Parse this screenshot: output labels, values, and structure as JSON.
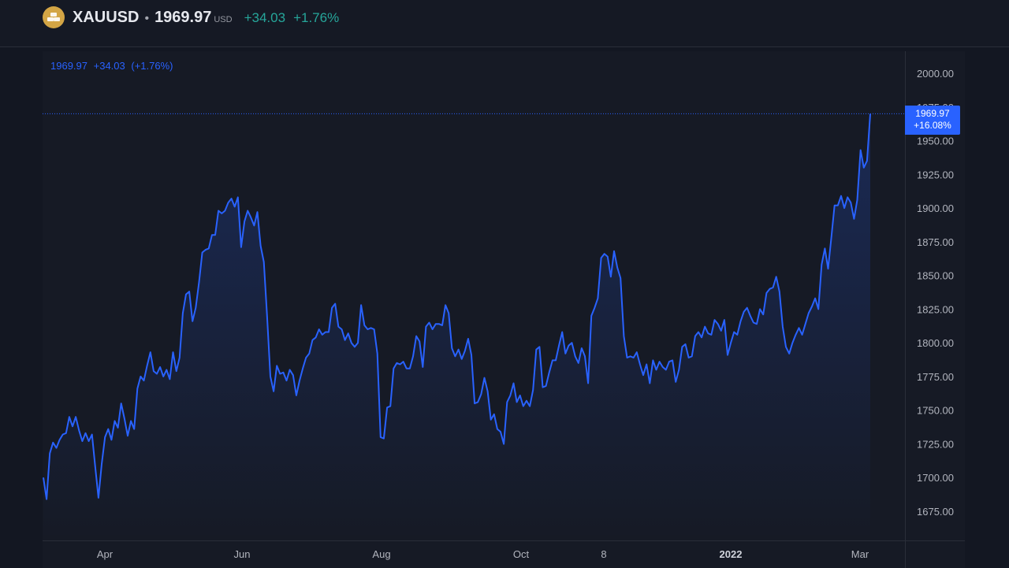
{
  "header": {
    "symbol": "XAUUSD",
    "separator": "•",
    "price": "1969.97",
    "currency": "USD",
    "change": "+34.03",
    "change_pct": "+1.76%",
    "logo_icon": "gold-bars-icon"
  },
  "legend": {
    "last": "1969.97",
    "change": "+34.03",
    "change_pct": "(+1.76%)"
  },
  "price_label": {
    "value": "1969.97",
    "change_pct": "+16.08%"
  },
  "colors": {
    "line": "#2962ff",
    "positive": "#26a69a",
    "background": "#131722"
  },
  "chart_data": {
    "type": "area",
    "title": "",
    "xlabel": "",
    "ylabel": "",
    "ylim": [
      1650,
      2020
    ],
    "y_ticks": [
      "1675.00",
      "1700.00",
      "1725.00",
      "1750.00",
      "1775.00",
      "1800.00",
      "1825.00",
      "1850.00",
      "1875.00",
      "1900.00",
      "1925.00",
      "1950.00",
      "1975.00",
      "2000.00"
    ],
    "x_ticks": [
      "Apr",
      "Jun",
      "Aug",
      "Oct",
      "8",
      "2022",
      "Mar"
    ],
    "x_ticks_bold": [
      "2022"
    ],
    "last_value": 1969.97,
    "values": [
      1700,
      1684,
      1718,
      1726,
      1722,
      1728,
      1732,
      1733,
      1745,
      1738,
      1745,
      1735,
      1727,
      1733,
      1727,
      1732,
      1708,
      1685,
      1710,
      1730,
      1736,
      1728,
      1742,
      1737,
      1755,
      1744,
      1731,
      1742,
      1736,
      1766,
      1775,
      1772,
      1783,
      1793,
      1779,
      1777,
      1782,
      1775,
      1780,
      1773,
      1793,
      1779,
      1789,
      1822,
      1836,
      1838,
      1816,
      1826,
      1845,
      1867,
      1869,
      1870,
      1880,
      1880,
      1898,
      1896,
      1898,
      1904,
      1907,
      1901,
      1908,
      1871,
      1890,
      1898,
      1893,
      1887,
      1897,
      1872,
      1860,
      1820,
      1775,
      1764,
      1783,
      1777,
      1778,
      1772,
      1780,
      1776,
      1761,
      1772,
      1781,
      1789,
      1792,
      1802,
      1804,
      1810,
      1806,
      1808,
      1808,
      1826,
      1829,
      1812,
      1810,
      1802,
      1807,
      1800,
      1797,
      1800,
      1828,
      1813,
      1810,
      1811,
      1810,
      1792,
      1730,
      1729,
      1752,
      1753,
      1781,
      1785,
      1784,
      1786,
      1781,
      1781,
      1790,
      1805,
      1801,
      1782,
      1812,
      1815,
      1810,
      1814,
      1814,
      1813,
      1828,
      1822,
      1796,
      1790,
      1795,
      1788,
      1794,
      1803,
      1791,
      1755,
      1756,
      1762,
      1774,
      1764,
      1743,
      1747,
      1736,
      1734,
      1725,
      1756,
      1761,
      1770,
      1756,
      1761,
      1753,
      1757,
      1753,
      1765,
      1795,
      1797,
      1767,
      1768,
      1778,
      1787,
      1787,
      1798,
      1808,
      1792,
      1798,
      1800,
      1790,
      1785,
      1796,
      1790,
      1770,
      1820,
      1826,
      1833,
      1863,
      1866,
      1864,
      1849,
      1868,
      1856,
      1848,
      1805,
      1789,
      1790,
      1789,
      1793,
      1784,
      1776,
      1784,
      1770,
      1787,
      1780,
      1786,
      1782,
      1780,
      1786,
      1787,
      1771,
      1780,
      1797,
      1799,
      1789,
      1790,
      1805,
      1808,
      1804,
      1812,
      1807,
      1806,
      1817,
      1814,
      1809,
      1817,
      1791,
      1800,
      1808,
      1806,
      1816,
      1823,
      1826,
      1820,
      1815,
      1814,
      1825,
      1821,
      1837,
      1840,
      1841,
      1849,
      1838,
      1812,
      1797,
      1792,
      1800,
      1806,
      1811,
      1806,
      1814,
      1822,
      1827,
      1833,
      1825,
      1858,
      1870,
      1855,
      1878,
      1902,
      1902,
      1909,
      1900,
      1908,
      1904,
      1892,
      1906,
      1943,
      1930,
      1935,
      1969.97
    ]
  }
}
